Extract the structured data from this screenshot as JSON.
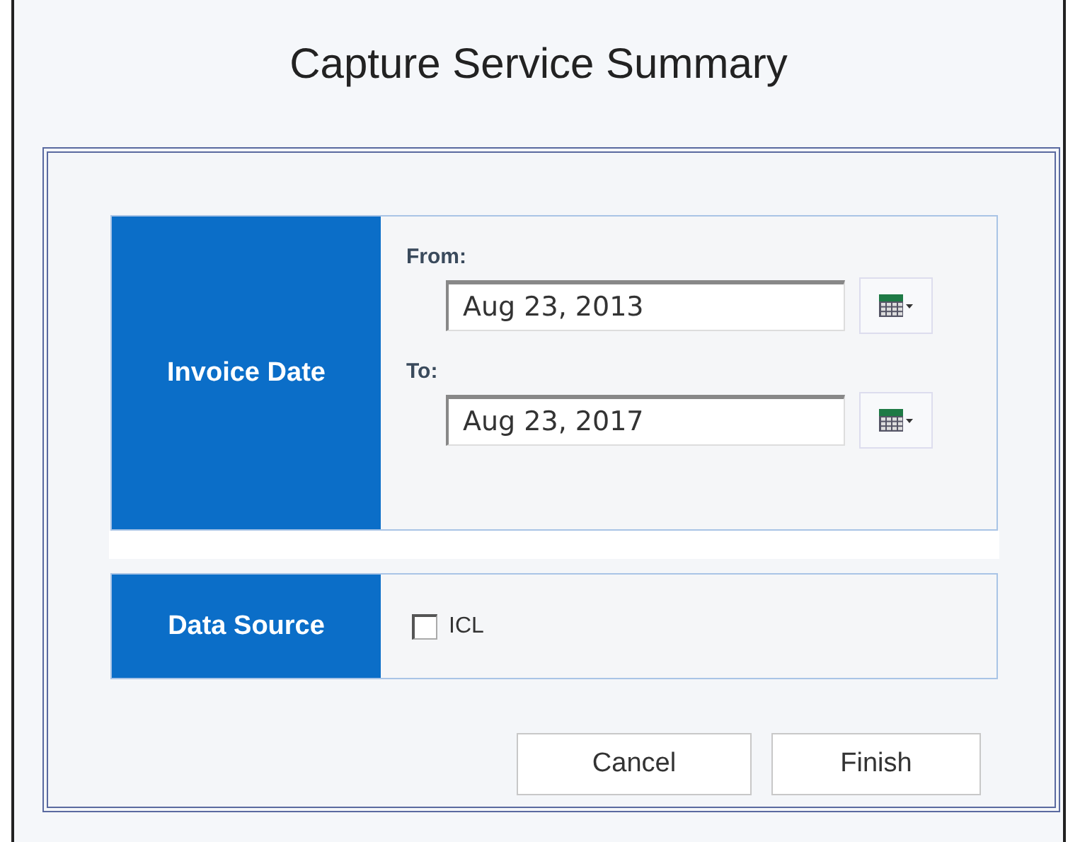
{
  "window": {
    "title": "Capture Service Summary"
  },
  "invoice_date": {
    "label": "Invoice Date",
    "fields": [
      {
        "label": "From:",
        "value": "Aug 23, 2013"
      },
      {
        "label": "To:",
        "value": "Aug 23, 2017"
      }
    ]
  },
  "data_source": {
    "label": "Data Source",
    "options": [
      {
        "label": "ICL",
        "checked": false
      }
    ]
  },
  "buttons": [
    "Cancel",
    "Finish"
  ]
}
